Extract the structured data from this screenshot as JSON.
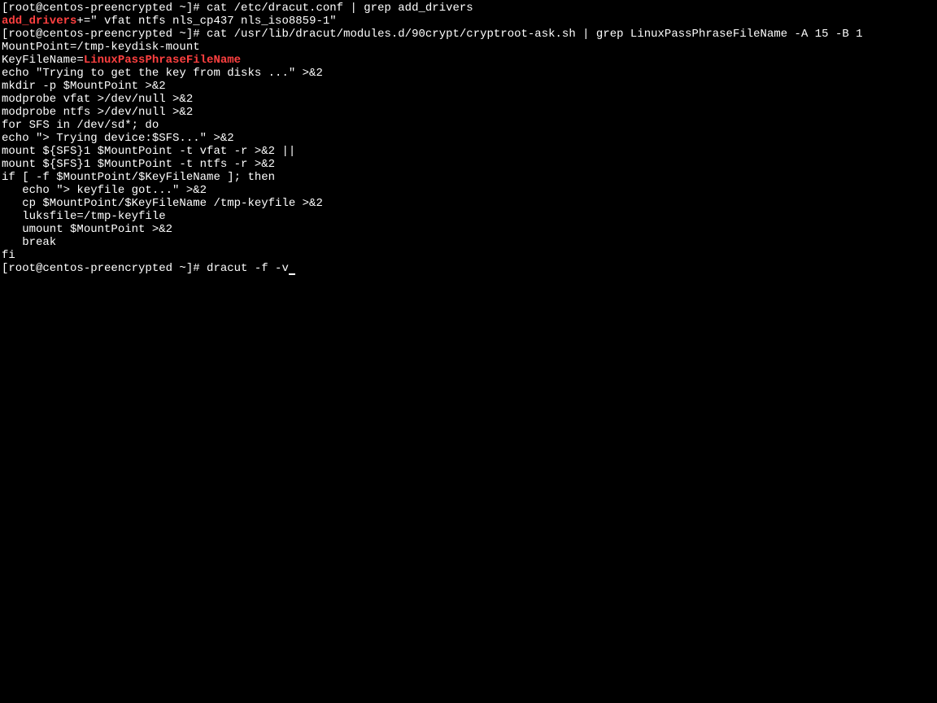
{
  "lines": [
    {
      "pre": "[root@centos-preencrypted ~]# cat /etc/dracut.conf | grep add_drivers"
    },
    {
      "hl": "add_drivers",
      "post": "+=\" vfat ntfs nls_cp437 nls_iso8859-1\""
    },
    {
      "pre": "[root@centos-preencrypted ~]# cat /usr/lib/dracut/modules.d/90crypt/cryptroot-ask.sh | grep LinuxPassPhraseFileName -A 15 -B 1"
    },
    {
      "pre": "MountPoint=/tmp-keydisk-mount"
    },
    {
      "pre": "KeyFileName=",
      "hl": "LinuxPassPhraseFileName"
    },
    {
      "pre": "echo \"Trying to get the key from disks ...\" >&2"
    },
    {
      "pre": "mkdir -p $MountPoint >&2"
    },
    {
      "pre": "modprobe vfat >/dev/null >&2"
    },
    {
      "pre": "modprobe ntfs >/dev/null >&2"
    },
    {
      "pre": "for SFS in /dev/sd*; do"
    },
    {
      "pre": "echo \"> Trying device:$SFS...\" >&2"
    },
    {
      "pre": "mount ${SFS}1 $MountPoint -t vfat -r >&2 ||"
    },
    {
      "pre": "mount ${SFS}1 $MountPoint -t ntfs -r >&2"
    },
    {
      "pre": "if [ -f $MountPoint/$KeyFileName ]; then"
    },
    {
      "pre": "   echo \"> keyfile got...\" >&2"
    },
    {
      "pre": "   cp $MountPoint/$KeyFileName /tmp-keyfile >&2"
    },
    {
      "pre": "   luksfile=/tmp-keyfile"
    },
    {
      "pre": "   umount $MountPoint >&2"
    },
    {
      "pre": "   break"
    },
    {
      "pre": "fi"
    },
    {
      "pre": "[root@centos-preencrypted ~]# dracut -f -v",
      "cursor": true
    }
  ],
  "colors": {
    "bg": "#000000",
    "fg": "#ffffff",
    "highlight": "#ff4040"
  }
}
